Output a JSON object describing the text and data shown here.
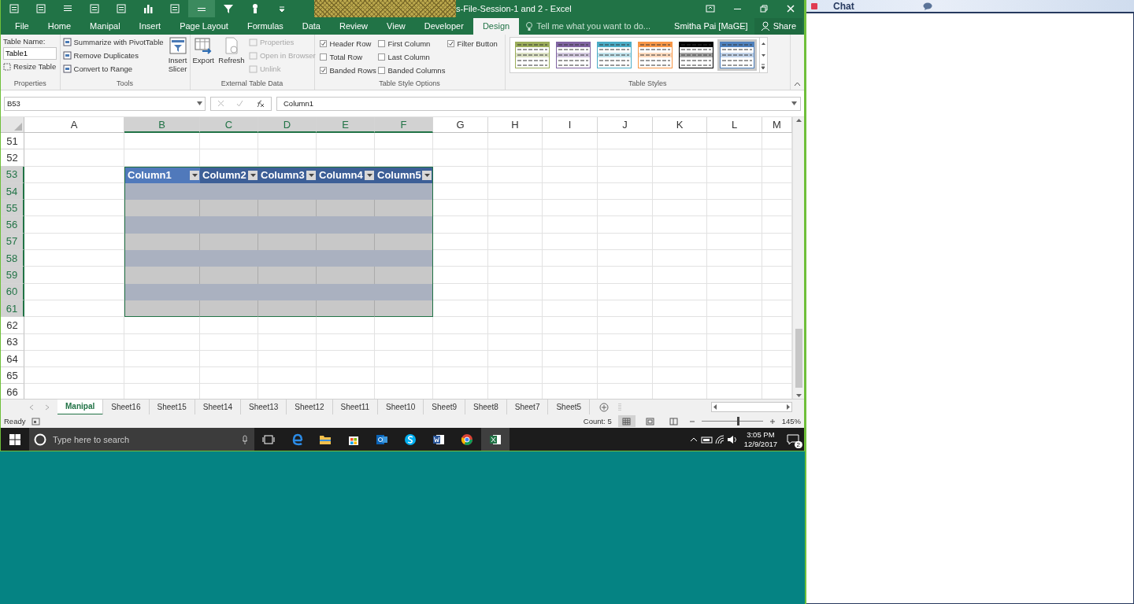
{
  "window": {
    "title": "s-File-Session-1 and 2 - Excel",
    "user": "Smitha Pai [MaGE]",
    "share": "Share"
  },
  "ribbon_tabs": [
    {
      "label": "File",
      "selected": false
    },
    {
      "label": "Home",
      "selected": false
    },
    {
      "label": "Manipal",
      "selected": false
    },
    {
      "label": "Insert",
      "selected": false
    },
    {
      "label": "Page Layout",
      "selected": false
    },
    {
      "label": "Formulas",
      "selected": false
    },
    {
      "label": "Data",
      "selected": false
    },
    {
      "label": "Review",
      "selected": false
    },
    {
      "label": "View",
      "selected": false
    },
    {
      "label": "Developer",
      "selected": false
    },
    {
      "label": "Design",
      "selected": true
    }
  ],
  "tell_me": {
    "placeholder": "Tell me what you want to do..."
  },
  "ribbon": {
    "properties": {
      "label": "Table Name:",
      "table_name": "Table1",
      "resize": "Resize Table",
      "group": "Properties"
    },
    "tools": {
      "items": [
        "Summarize with PivotTable",
        "Remove Duplicates",
        "Convert to Range"
      ],
      "slicer": "Insert Slicer",
      "group": "Tools"
    },
    "external": {
      "big": [
        "Export",
        "Refresh"
      ],
      "small": [
        {
          "label": "Properties",
          "disabled": true
        },
        {
          "label": "Open in Browser",
          "disabled": true
        },
        {
          "label": "Unlink",
          "disabled": true
        }
      ],
      "group": "External Table Data"
    },
    "style_options": {
      "options": [
        {
          "label": "Header Row",
          "checked": true
        },
        {
          "label": "Total Row",
          "checked": false
        },
        {
          "label": "Banded Rows",
          "checked": true
        },
        {
          "label": "First Column",
          "checked": false
        },
        {
          "label": "Last Column",
          "checked": false
        },
        {
          "label": "Banded Columns",
          "checked": false
        },
        {
          "label": "Filter Button",
          "checked": true
        }
      ],
      "group": "Table Style Options"
    },
    "styles": {
      "swatches": [
        {
          "color": "#9bad5a",
          "selected": false
        },
        {
          "color": "#8064a2",
          "selected": false
        },
        {
          "color": "#4bacc6",
          "selected": false
        },
        {
          "color": "#f79646",
          "selected": false
        },
        {
          "color": "#000000",
          "selected": false
        },
        {
          "color": "#4f81bd",
          "selected": true
        }
      ],
      "group": "Table Styles"
    }
  },
  "formula_bar": {
    "name_box": "B53",
    "formula": "Column1"
  },
  "columns": [
    {
      "label": "A",
      "selected": false
    },
    {
      "label": "B",
      "selected": true
    },
    {
      "label": "C",
      "selected": true
    },
    {
      "label": "D",
      "selected": true
    },
    {
      "label": "E",
      "selected": true
    },
    {
      "label": "F",
      "selected": true
    },
    {
      "label": "G",
      "selected": false
    },
    {
      "label": "H",
      "selected": false
    },
    {
      "label": "I",
      "selected": false
    },
    {
      "label": "J",
      "selected": false
    },
    {
      "label": "K",
      "selected": false
    },
    {
      "label": "L",
      "selected": false
    },
    {
      "label": "M",
      "selected": false
    }
  ],
  "rows": [
    {
      "number": "51",
      "selected": false,
      "kind": "blank"
    },
    {
      "number": "52",
      "selected": false,
      "kind": "blank"
    },
    {
      "number": "53",
      "selected": true,
      "kind": "table_header"
    },
    {
      "number": "54",
      "selected": true,
      "kind": "table_band"
    },
    {
      "number": "55",
      "selected": true,
      "kind": "table_row"
    },
    {
      "number": "56",
      "selected": true,
      "kind": "table_band"
    },
    {
      "number": "57",
      "selected": true,
      "kind": "table_row"
    },
    {
      "number": "58",
      "selected": true,
      "kind": "table_band"
    },
    {
      "number": "59",
      "selected": true,
      "kind": "table_row"
    },
    {
      "number": "60",
      "selected": true,
      "kind": "table_band"
    },
    {
      "number": "61",
      "selected": true,
      "kind": "table_row"
    },
    {
      "number": "62",
      "selected": false,
      "kind": "blank"
    },
    {
      "number": "63",
      "selected": false,
      "kind": "blank"
    },
    {
      "number": "64",
      "selected": false,
      "kind": "blank"
    },
    {
      "number": "65",
      "selected": false,
      "kind": "blank"
    },
    {
      "number": "66",
      "selected": false,
      "kind": "blank"
    }
  ],
  "table": {
    "headers": [
      {
        "label": "Column1",
        "active": true
      },
      {
        "label": "Column2",
        "active": false
      },
      {
        "label": "Column3",
        "active": false
      },
      {
        "label": "Column4",
        "active": false
      },
      {
        "label": "Column5",
        "active": false
      }
    ]
  },
  "sheets": [
    {
      "label": "Manipal",
      "selected": true
    },
    {
      "label": "Sheet16",
      "selected": false
    },
    {
      "label": "Sheet15",
      "selected": false
    },
    {
      "label": "Sheet14",
      "selected": false
    },
    {
      "label": "Sheet13",
      "selected": false
    },
    {
      "label": "Sheet12",
      "selected": false
    },
    {
      "label": "Sheet11",
      "selected": false
    },
    {
      "label": "Sheet10",
      "selected": false
    },
    {
      "label": "Sheet9",
      "selected": false
    },
    {
      "label": "Sheet8",
      "selected": false
    },
    {
      "label": "Sheet7",
      "selected": false
    },
    {
      "label": "Sheet5",
      "selected": false
    }
  ],
  "status_bar": {
    "status": "Ready",
    "count": "Count: 5",
    "zoom": "145%",
    "zoom_slider": {
      "level": 0.58
    }
  },
  "taskbar": {
    "search_placeholder": "Type here to search",
    "time": "3:05 PM",
    "date": "12/9/2017",
    "notifications": "2"
  },
  "chat": {
    "title": "Chat"
  }
}
